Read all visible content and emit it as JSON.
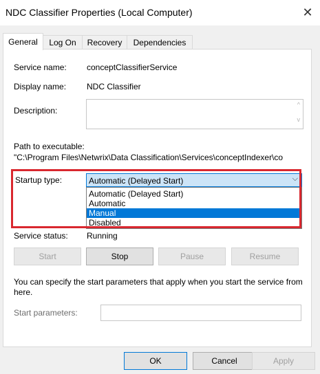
{
  "window": {
    "title": "NDC Classifier Properties (Local Computer)",
    "close_glyph": "✕"
  },
  "tabs": [
    {
      "label": "General"
    },
    {
      "label": "Log On"
    },
    {
      "label": "Recovery"
    },
    {
      "label": "Dependencies"
    }
  ],
  "general": {
    "service_name_label": "Service name:",
    "service_name_value": "conceptClassifierService",
    "display_name_label": "Display name:",
    "display_name_value": "NDC Classifier",
    "description_label": "Description:",
    "description_scroll_up": "^",
    "description_scroll_down": "v",
    "path_label": "Path to executable:",
    "path_value": "\"C:\\Program Files\\Netwrix\\Data Classification\\Services\\conceptIndexer\\co",
    "startup_type_label": "Startup type:",
    "startup_type_selected": "Automatic (Delayed Start)",
    "startup_chevron": "⌵",
    "startup_options": [
      "Automatic (Delayed Start)",
      "Automatic",
      "Manual",
      "Disabled"
    ],
    "highlighted_option": "Manual",
    "service_status_label": "Service status:",
    "service_status_value": "Running"
  },
  "service_buttons": {
    "start": "Start",
    "stop": "Stop",
    "pause": "Pause",
    "resume": "Resume"
  },
  "info_text": "You can specify the start parameters that apply when you start the service from here.",
  "start_parameters_label": "Start parameters:",
  "start_parameters_value": "",
  "dialog_buttons": {
    "ok": "OK",
    "cancel": "Cancel",
    "apply": "Apply"
  },
  "colors": {
    "highlight": "#0078d7",
    "annotation_border": "#d9272e"
  }
}
